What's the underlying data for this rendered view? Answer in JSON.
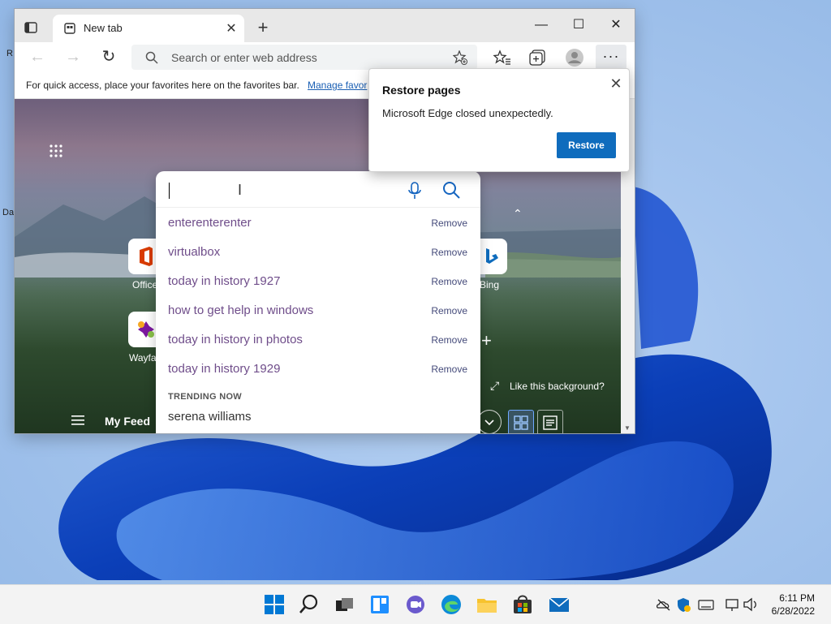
{
  "browser": {
    "tab": {
      "title": "New tab",
      "close": "✕"
    },
    "new_tab": "+",
    "window_controls": {
      "minimize": "—",
      "maximize": "☐",
      "close": "✕"
    },
    "address_placeholder": "Search or enter web address",
    "more_label": "···",
    "favorites_bar": {
      "message": "For quick access, place your favorites here on the favorites bar.",
      "link": "Manage favor"
    }
  },
  "new_tab_page": {
    "quick_links": [
      {
        "label": "Office"
      },
      {
        "label": "Wayfa"
      },
      {
        "label": "Bing"
      }
    ],
    "background_prompt": "Like this background?",
    "my_feed": "My Feed",
    "plus": "+",
    "chevron_up": "⌃"
  },
  "search": {
    "query": "",
    "suggestions": [
      {
        "text": "enterenterenter",
        "action": "Remove"
      },
      {
        "text": "virtualbox",
        "action": "Remove"
      },
      {
        "text": "today in history 1927",
        "action": "Remove"
      },
      {
        "text": "how to get help in windows",
        "action": "Remove"
      },
      {
        "text": "today in history in photos",
        "action": "Remove"
      },
      {
        "text": "today in history 1929",
        "action": "Remove"
      }
    ],
    "trending_header": "TRENDING NOW",
    "trending": [
      "serena williams"
    ]
  },
  "restore_dialog": {
    "title": "Restore pages",
    "message": "Microsoft Edge closed unexpectedly.",
    "button": "Restore",
    "close": "✕"
  },
  "taskbar": {
    "time": "6:11 PM",
    "date": "6/28/2022",
    "apps": [
      "start-icon",
      "search-icon",
      "task-view-icon",
      "widgets-icon",
      "chat-icon",
      "edge-icon",
      "file-explorer-icon",
      "store-icon",
      "mail-icon"
    ]
  },
  "colors": {
    "accent": "#0f6cbd",
    "suggestion_text": "#6f4d8a"
  }
}
